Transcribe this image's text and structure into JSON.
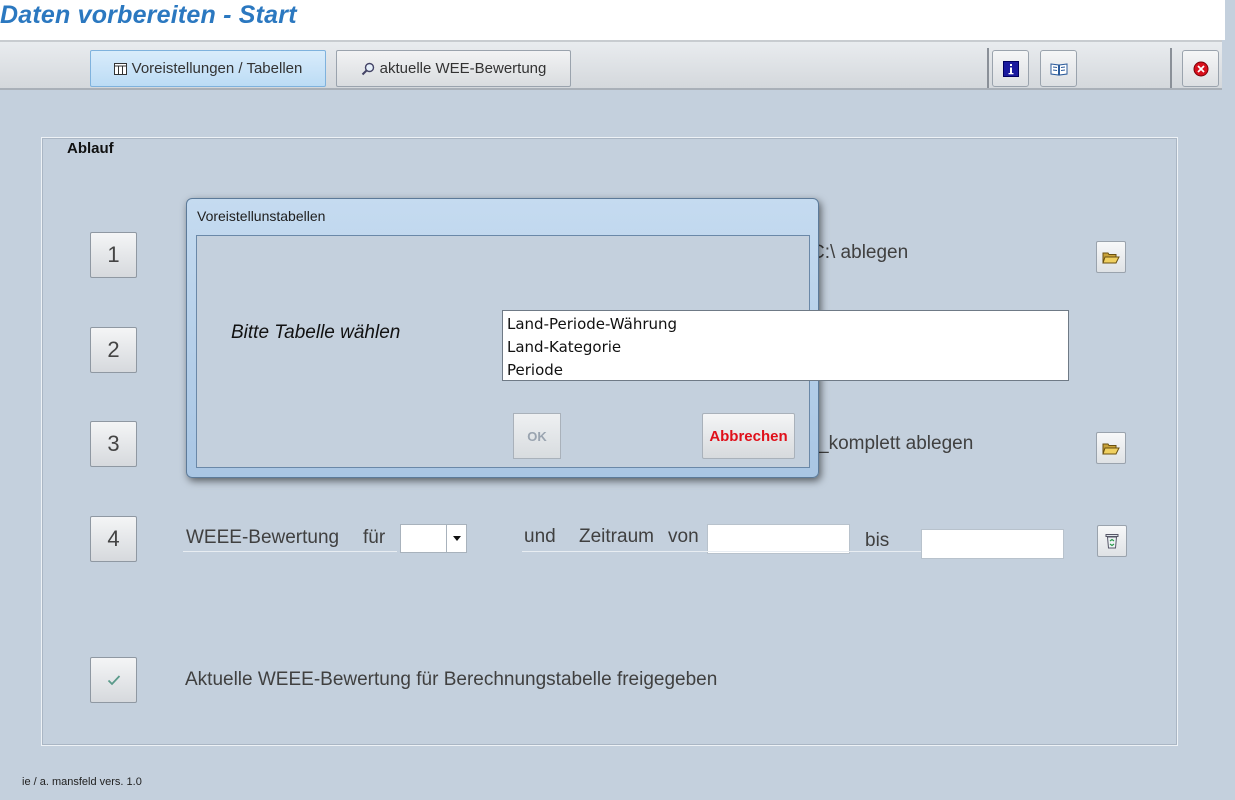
{
  "window": {
    "title": "Daten vorbereiten - Start"
  },
  "toolbar": {
    "voreinstellungen_label": "Voreistellungen / Tabellen",
    "wee_label": "aktuelle WEE-Bewertung"
  },
  "main": {
    "section_label": "Ablauf",
    "steps": [
      {
        "number": "1",
        "text_visible": "C:\\ ablegen"
      },
      {
        "number": "2"
      },
      {
        "number": "3",
        "text_visible": "_komplett ablegen"
      },
      {
        "number": "4",
        "label_a": "WEEE-Bewertung",
        "label_b": "für",
        "label_c": "und",
        "label_d": "Zeitraum",
        "label_e": "von",
        "label_f": "bis"
      }
    ],
    "release_text": "Aktuelle WEEE-Bewertung für Berechnungstabelle freigegeben"
  },
  "footer": {
    "text": "ie / a. mansfeld vers. 1.0"
  },
  "dialog": {
    "title": "Voreistellunstabellen",
    "prompt": "Bitte Tabelle wählen",
    "ok_label": "OK",
    "cancel_label": "Abbrechen",
    "combo_color": "#ffff00",
    "options": [
      "Land-Periode-Währung",
      "Land-Kategorie",
      "Periode"
    ]
  },
  "colors": {
    "title": "#2b78c0",
    "background": "#c4d0dd",
    "cancel_text": "#e0101a"
  },
  "icons": [
    "table-icon",
    "magnifier-icon",
    "info-icon",
    "book-icon",
    "close-icon",
    "folder-open-icon",
    "recycle-bin-icon",
    "checkmark-icon",
    "dropdown-arrow-icon"
  ]
}
